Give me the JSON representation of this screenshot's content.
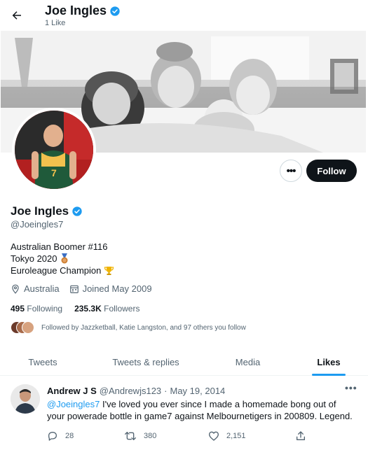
{
  "topbar": {
    "name": "Joe Ingles",
    "subtitle": "1 Like"
  },
  "profile": {
    "display_name": "Joe Ingles",
    "handle": "@Joeingles7",
    "bio": {
      "line1": "Australian Boomer #116",
      "line2": "Tokyo 2020",
      "line3": "Euroleague Champion"
    },
    "location": "Australia",
    "joined": "Joined May 2009",
    "following_count": "495",
    "following_label": "Following",
    "followers_count": "235.3K",
    "followers_label": "Followers",
    "followed_by": "Followed by Jazzketball, Katie Langston, and 97 others you follow",
    "follow_button": "Follow",
    "more_button": "•••"
  },
  "tabs": [
    "Tweets",
    "Tweets & replies",
    "Media",
    "Likes"
  ],
  "active_tab": "Likes",
  "tweet": {
    "author_name": "Andrew J S",
    "author_handle": "@Andrewjs123",
    "separator": "·",
    "date": "May 19, 2014",
    "mention": "@Joeingles7",
    "text": " I've loved you ever since I made a homemade bong out of your powerade bottle in game7 against Melbournetigers in 200809. Legend.",
    "replies": "28",
    "retweets": "380",
    "likes": "2,151",
    "more": "•••"
  },
  "colors": {
    "accent": "#1d9bf0",
    "text": "#0f1419",
    "muted": "#536471",
    "follow_bg": "#0f1419",
    "verified": "#1d9bf0",
    "medal": "#cd7f32",
    "trophy": "#f0b400"
  },
  "icons": {
    "back": "back-arrow-icon",
    "verified": "verified-badge-icon",
    "location": "location-pin-icon",
    "calendar": "calendar-icon",
    "medal": "bronze-medal-icon",
    "trophy": "trophy-icon",
    "reply": "reply-icon",
    "retweet": "retweet-icon",
    "like": "heart-icon",
    "share": "share-icon"
  }
}
